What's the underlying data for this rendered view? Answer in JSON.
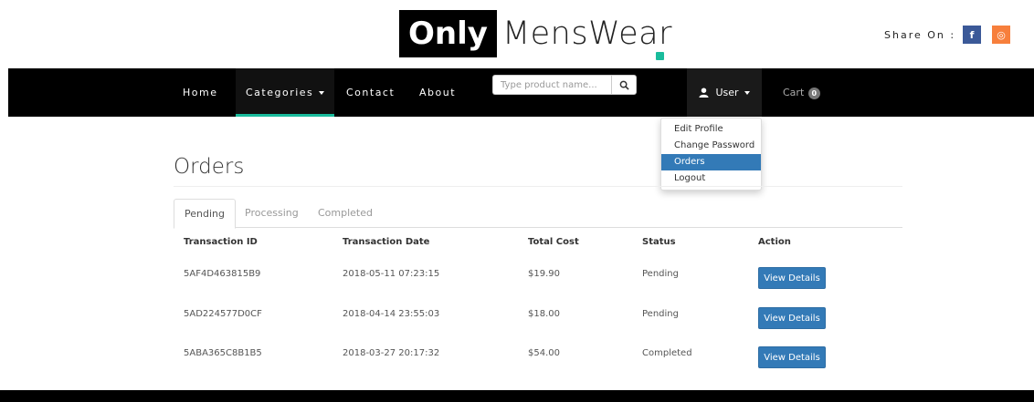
{
  "brand": {
    "strong": "Only",
    "rest": "MensWear"
  },
  "share": {
    "label": "Share On :",
    "facebook": "f",
    "instagram": "◎"
  },
  "nav": {
    "home": "Home",
    "categories": "Categories",
    "contact": "Contact",
    "about": "About",
    "search_placeholder": "Type product name...",
    "user": "User",
    "cart_label": "Cart",
    "cart_count": "0"
  },
  "user_menu": {
    "items": [
      {
        "label": "Edit Profile"
      },
      {
        "label": "Change Password"
      },
      {
        "label": "Orders"
      },
      {
        "label": "Logout"
      }
    ]
  },
  "page": {
    "title": "Orders"
  },
  "tabs": [
    {
      "label": "Pending"
    },
    {
      "label": "Processing"
    },
    {
      "label": "Completed"
    }
  ],
  "table": {
    "headers": [
      "Transaction ID",
      "Transaction Date",
      "Total Cost",
      "Status",
      "Action"
    ],
    "rows": [
      {
        "id": "5AF4D463815B9",
        "date": "2018-05-11 07:23:15",
        "cost": "$19.90",
        "status": "Pending",
        "action": "View Details"
      },
      {
        "id": "5AD224577D0CF",
        "date": "2018-04-14 23:55:03",
        "cost": "$18.00",
        "status": "Pending",
        "action": "View Details"
      },
      {
        "id": "5ABA365C8B1B5",
        "date": "2018-03-27 20:17:32",
        "cost": "$54.00",
        "status": "Completed",
        "action": "View Details"
      }
    ]
  },
  "colors": {
    "accent": "#1abc9c",
    "primary": "#337ab7",
    "navbar": "#000000"
  }
}
